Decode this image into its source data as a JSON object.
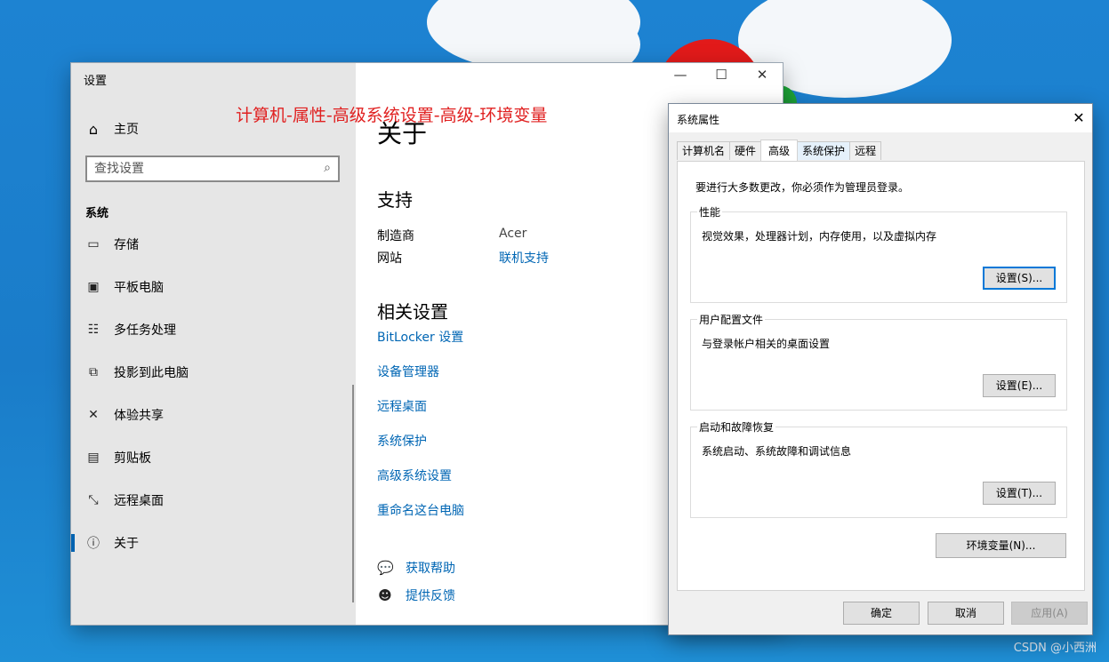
{
  "settings": {
    "window_title": "设置",
    "home_label": "主页",
    "search_placeholder": "查找设置",
    "section_heading": "系统",
    "nav": [
      {
        "label": "存储",
        "icon": "storage-icon"
      },
      {
        "label": "平板电脑",
        "icon": "tablet-icon"
      },
      {
        "label": "多任务处理",
        "icon": "multitask-icon"
      },
      {
        "label": "投影到此电脑",
        "icon": "project-icon"
      },
      {
        "label": "体验共享",
        "icon": "share-icon"
      },
      {
        "label": "剪贴板",
        "icon": "clipboard-icon"
      },
      {
        "label": "远程桌面",
        "icon": "remote-desktop-icon"
      },
      {
        "label": "关于",
        "icon": "info-icon"
      }
    ],
    "annotation": "计算机-属性-高级系统设置-高级-环境变量",
    "page_title": "关于",
    "support_heading": "支持",
    "support": {
      "manufacturer_label": "制造商",
      "manufacturer_value": "Acer",
      "website_label": "网站",
      "website_value": "联机支持"
    },
    "related_heading": "相关设置",
    "related_links": [
      "BitLocker 设置",
      "设备管理器",
      "远程桌面",
      "系统保护",
      "高级系统设置",
      "重命名这台电脑"
    ],
    "help": {
      "get_help": "获取帮助",
      "feedback": "提供反馈"
    },
    "controls": {
      "minimize": "—",
      "maximize": "☐",
      "close": "✕"
    }
  },
  "dialog": {
    "title": "系统属性",
    "close": "✕",
    "tabs": [
      "计算机名",
      "硬件",
      "高级",
      "系统保护",
      "远程"
    ],
    "selected_tab": "高级",
    "admin_note": "要进行大多数更改，你必须作为管理员登录。",
    "groups": [
      {
        "label": "性能",
        "desc": "视觉效果，处理器计划，内存使用，以及虚拟内存",
        "button": "设置(S)..."
      },
      {
        "label": "用户配置文件",
        "desc": "与登录帐户相关的桌面设置",
        "button": "设置(E)..."
      },
      {
        "label": "启动和故障恢复",
        "desc": "系统启动、系统故障和调试信息",
        "button": "设置(T)..."
      }
    ],
    "env_button": "环境变量(N)...",
    "ok": "确定",
    "cancel": "取消",
    "apply": "应用(A)"
  },
  "watermark": "CSDN @小西洲",
  "colors": {
    "accent": "#0078d7",
    "link": "#0066b4",
    "annotation": "#e02020"
  }
}
